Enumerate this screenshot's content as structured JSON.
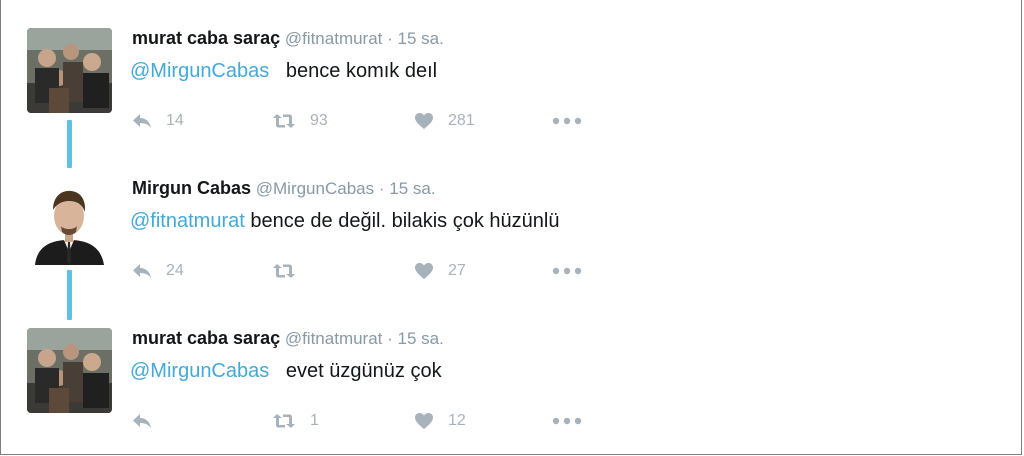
{
  "tweets": [
    {
      "name": "murat caba saraç",
      "handle": "@fitnatmurat",
      "sep": "·",
      "time": "15 sa.",
      "mention": "@MirgunCabas",
      "body": "bence komık deıl",
      "reply_count": "14",
      "retweet_count": "93",
      "like_count": "281"
    },
    {
      "name": "Mirgun Cabas",
      "handle": "@MirgunCabas",
      "sep": "·",
      "time": "15 sa.",
      "mention": "@fitnatmurat",
      "body": "bence de değil. bilakis çok hüzünlü",
      "reply_count": "24",
      "retweet_count": "",
      "like_count": "27"
    },
    {
      "name": "murat caba saraç",
      "handle": "@fitnatmurat",
      "sep": "·",
      "time": "15 sa.",
      "mention": "@MirgunCabas",
      "body": "evet üzgünüz çok",
      "reply_count": "",
      "retweet_count": "1",
      "like_count": "12"
    }
  ],
  "icons": {
    "reply": "reply-icon",
    "retweet": "retweet-icon",
    "like": "heart-icon",
    "more": "more-icon"
  },
  "colors": {
    "mention": "#42a9d9",
    "thread_line": "#5fc1e0",
    "meta": "#8899a6",
    "action": "#a8b2bb"
  }
}
